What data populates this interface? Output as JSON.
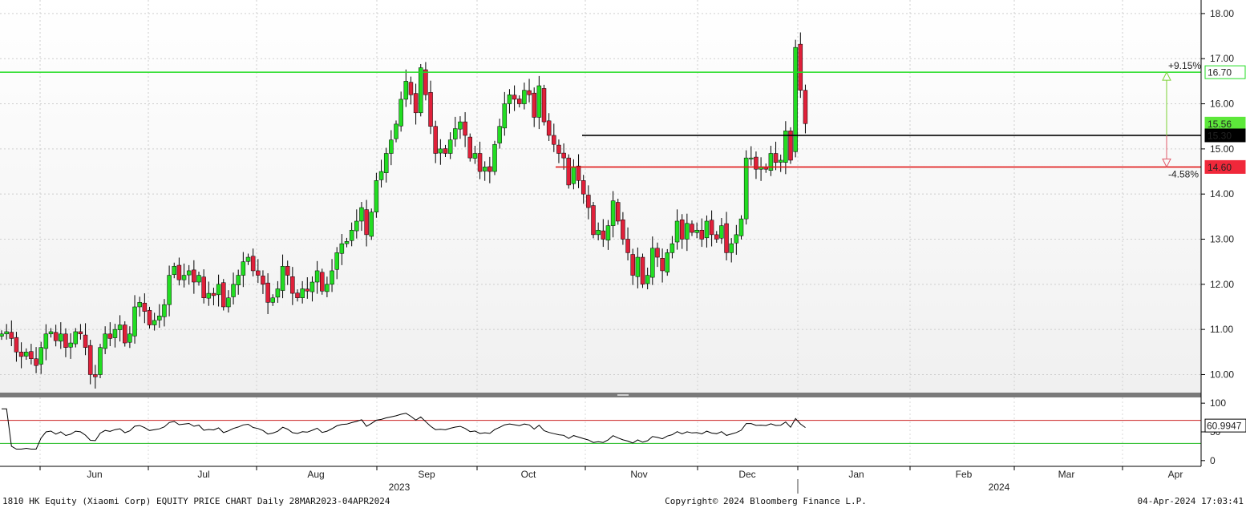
{
  "footer": {
    "left": "1810 HK Equity (Xiaomi Corp) EQUITY PRICE CHART  Daily 28MAR2023-04APR2024",
    "center": "Copyright© 2024 Bloomberg Finance L.P.",
    "right": "04-Apr-2024 17:03:41"
  },
  "colors": {
    "up": "#22dd22",
    "down": "#e0203a",
    "resistance": "#22dd22",
    "support": "#e01818",
    "pivot": "#000000",
    "rsi_line": "#000000",
    "rsi_overbought": "#cc2222",
    "rsi_oversold": "#22bb22"
  },
  "chart_data": [
    {
      "type": "candlestick",
      "title": "",
      "y_axis": {
        "position": "right",
        "ylim": [
          9.6,
          18.3
        ],
        "ticks": [
          10.0,
          11.0,
          12.0,
          13.0,
          14.0,
          15.0,
          16.0,
          17.0,
          18.0
        ],
        "tick_labels": [
          "10.00",
          "11.00",
          "12.00",
          "13.00",
          "14.00",
          "15.00",
          "16.00",
          "17.00",
          "18.00"
        ]
      },
      "x_axis": {
        "months": [
          "Jun",
          "Jul",
          "Aug",
          "Sep",
          "Oct",
          "Nov",
          "Dec",
          "Jan",
          "Feb",
          "Mar",
          "Apr"
        ],
        "years": [
          "2023",
          "2024"
        ]
      },
      "grid": true,
      "horizontal_lines": [
        {
          "name": "resistance",
          "value": 16.7,
          "label": "16.70",
          "pct_label": "+9.15%"
        },
        {
          "name": "pivot",
          "value": 15.3,
          "label": "15.30"
        },
        {
          "name": "support",
          "value": 14.6,
          "label": "14.60",
          "pct_label": "-4.58%"
        }
      ],
      "last_price_label": "15.56",
      "series_close": [
        10.9,
        10.95,
        10.8,
        10.5,
        10.4,
        10.5,
        10.35,
        10.2,
        10.6,
        10.9,
        10.95,
        10.75,
        10.9,
        10.6,
        10.7,
        10.95,
        10.9,
        10.6,
        10.0,
        9.95,
        10.6,
        10.9,
        10.8,
        11.0,
        11.1,
        10.7,
        10.9,
        11.5,
        11.6,
        11.4,
        11.1,
        11.2,
        11.3,
        11.55,
        12.2,
        12.4,
        12.1,
        12.2,
        12.3,
        12.05,
        12.2,
        11.7,
        11.8,
        11.75,
        12.0,
        11.5,
        11.7,
        12.0,
        12.2,
        12.5,
        12.6,
        12.3,
        12.2,
        12.0,
        11.6,
        11.7,
        11.9,
        12.4,
        12.2,
        11.8,
        11.7,
        11.9,
        11.85,
        12.05,
        12.3,
        11.85,
        12.0,
        12.3,
        12.7,
        12.9,
        12.95,
        13.2,
        13.4,
        13.7,
        13.1,
        13.6,
        14.3,
        14.5,
        14.9,
        15.2,
        15.55,
        16.1,
        16.5,
        16.2,
        15.8,
        16.8,
        16.2,
        15.5,
        14.9,
        15.0,
        14.9,
        15.2,
        15.45,
        15.6,
        15.3,
        14.8,
        14.9,
        14.5,
        14.6,
        14.5,
        15.1,
        15.5,
        16.0,
        16.2,
        16.1,
        16.0,
        16.3,
        16.2,
        15.7,
        16.4,
        15.6,
        15.3,
        15.1,
        14.9,
        14.8,
        14.2,
        14.6,
        14.3,
        14.0,
        13.7,
        13.1,
        13.2,
        13.0,
        13.3,
        13.85,
        13.4,
        13.0,
        12.7,
        12.2,
        12.6,
        12.0,
        12.2,
        12.8,
        12.6,
        12.3,
        12.7,
        12.9,
        13.4,
        13.0,
        13.35,
        13.15,
        13.2,
        13.0,
        13.4,
        13.1,
        13.0,
        13.3,
        12.7,
        12.9,
        13.1,
        13.45,
        14.8,
        14.8,
        14.55,
        14.6,
        14.55,
        14.9,
        14.7,
        14.75,
        15.4,
        14.75,
        17.25,
        16.3,
        15.56
      ],
      "rsi": {
        "ylim": [
          -10,
          110
        ],
        "ticks": [
          0,
          50,
          100
        ],
        "tick_labels": [
          "0",
          "50",
          "100"
        ],
        "overbought": 70,
        "oversold": 30,
        "last_value": 60.9947,
        "last_label": "60.9947"
      }
    }
  ]
}
